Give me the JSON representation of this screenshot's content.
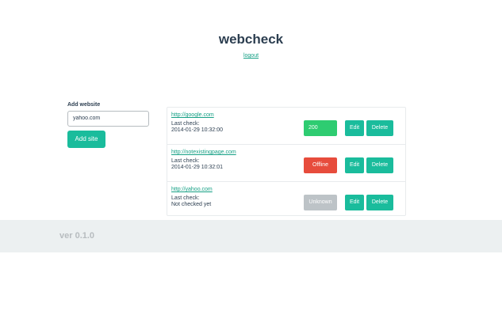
{
  "header": {
    "title": "webcheck",
    "logout_label": "logout"
  },
  "add_form": {
    "label": "Add website",
    "input_value": "yahoo.com",
    "button_label": "Add site"
  },
  "sites": [
    {
      "url": "http://google.com",
      "last_check_label": "Last check:",
      "last_check_value": "2014-01-29 10:32:00",
      "status": "200",
      "edit_label": "Edit",
      "delete_label": "Delete"
    },
    {
      "url": "http://notexistingpage.com",
      "last_check_label": "Last check:",
      "last_check_value": "2014-01-29 10:32:01",
      "status": "Offline",
      "edit_label": "Edit",
      "delete_label": "Delete"
    },
    {
      "url": "http://yahoo.com",
      "last_check_label": "Last check:",
      "last_check_value": "Not checked yet",
      "status": "Unknown",
      "edit_label": "Edit",
      "delete_label": "Delete"
    }
  ],
  "footer": {
    "version": "ver 0.1.0"
  },
  "colors": {
    "accent": "#1abc9c",
    "status_ok": "#2ecc71",
    "status_offline": "#e74c3c",
    "status_unknown": "#bdc3c7",
    "text": "#2c3e50",
    "footer_bg": "#ecf0f1"
  }
}
